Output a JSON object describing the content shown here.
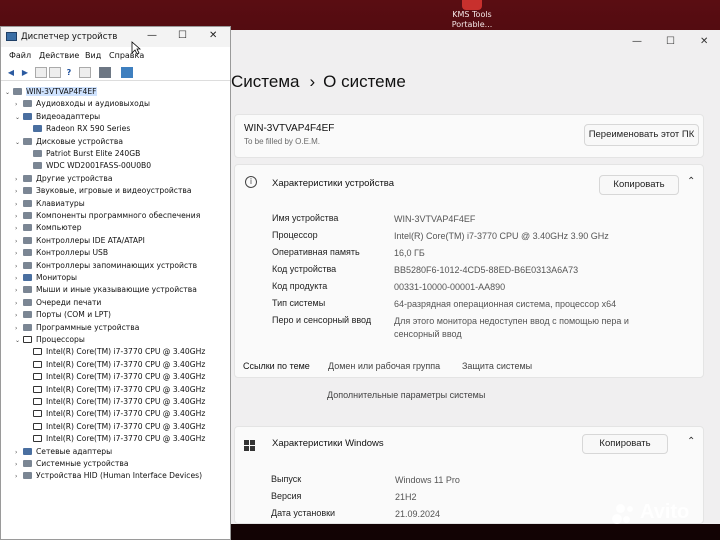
{
  "desktop": {
    "icon_label_1": "KMS Tools",
    "icon_label_2": "Portable..."
  },
  "settings": {
    "breadcrumb": [
      "Система",
      "О системе"
    ],
    "device_name_heading": "WIN-3VTVAP4F4EF",
    "device_subtitle": "To be filled by O.E.M.",
    "rename_button": "Переименовать этот ПК",
    "device_specs_title": "Характеристики устройства",
    "copy_button": "Копировать",
    "specs": [
      {
        "label": "Имя устройства",
        "value": "WIN-3VTVAP4F4EF"
      },
      {
        "label": "Процессор",
        "value": "Intel(R) Core(TM) i7-3770 CPU @ 3.40GHz   3.90 GHz"
      },
      {
        "label": "Оперативная память",
        "value": "16,0 ГБ"
      },
      {
        "label": "Код устройства",
        "value": "BB5280F6-1012-4CD5-88ED-B6E0313A6A73"
      },
      {
        "label": "Код продукта",
        "value": "00331-10000-00001-AA890"
      },
      {
        "label": "Тип системы",
        "value": "64-разрядная операционная система, процессор x64"
      },
      {
        "label": "Перо и сенсорный ввод",
        "value": "Для этого монитора недоступен ввод с помощью пера и сенсорный ввод"
      }
    ],
    "related_label": "Ссылки по теме",
    "related_links": [
      "Домен или рабочая группа",
      "Защита системы"
    ],
    "advanced_link": "Дополнительные параметры системы",
    "windows_specs_title": "Характеристики Windows",
    "windows_copy_button": "Копировать",
    "windows_specs": [
      {
        "label": "Выпуск",
        "value": "Windows 11 Pro"
      },
      {
        "label": "Версия",
        "value": "21H2"
      },
      {
        "label": "Дата установки",
        "value": "21.09.2024"
      }
    ]
  },
  "device_manager": {
    "title": "Диспетчер устройств",
    "menu": [
      "Файл",
      "Действие",
      "Вид",
      "Справка"
    ],
    "tree": [
      {
        "label": "WIN-3VTVAP4F4EF",
        "level": 0,
        "expanded": true,
        "icon": "computer"
      },
      {
        "label": "Аудиовходы и аудиовыходы",
        "level": 1,
        "expanded": false,
        "icon": "audio"
      },
      {
        "label": "Видеоадаптеры",
        "level": 1,
        "expanded": true,
        "icon": "display"
      },
      {
        "label": "Radeon RX 590 Series",
        "level": 2,
        "icon": "gpu"
      },
      {
        "label": "Дисковые устройства",
        "level": 1,
        "expanded": true,
        "icon": "disk"
      },
      {
        "label": "Patriot Burst Elite 240GB",
        "level": 2,
        "icon": "disk"
      },
      {
        "label": "WDC WD2001FASS-00U0B0",
        "level": 2,
        "icon": "disk"
      },
      {
        "label": "Другие устройства",
        "level": 1,
        "expanded": false,
        "icon": "other"
      },
      {
        "label": "Звуковые, игровые и видеоустройства",
        "level": 1,
        "expanded": false,
        "icon": "sound"
      },
      {
        "label": "Клавиатуры",
        "level": 1,
        "expanded": false,
        "icon": "keyboard"
      },
      {
        "label": "Компоненты программного обеспечения",
        "level": 1,
        "expanded": false,
        "icon": "software"
      },
      {
        "label": "Компьютер",
        "level": 1,
        "expanded": false,
        "icon": "computer"
      },
      {
        "label": "Контроллеры IDE ATA/ATAPI",
        "level": 1,
        "expanded": false,
        "icon": "controller"
      },
      {
        "label": "Контроллеры USB",
        "level": 1,
        "expanded": false,
        "icon": "usb"
      },
      {
        "label": "Контроллеры запоминающих устройств",
        "level": 1,
        "expanded": false,
        "icon": "storage"
      },
      {
        "label": "Мониторы",
        "level": 1,
        "expanded": false,
        "icon": "monitor"
      },
      {
        "label": "Мыши и иные указывающие устройства",
        "level": 1,
        "expanded": false,
        "icon": "mouse"
      },
      {
        "label": "Очереди печати",
        "level": 1,
        "expanded": false,
        "icon": "printer"
      },
      {
        "label": "Порты (COM и LPT)",
        "level": 1,
        "expanded": false,
        "icon": "port"
      },
      {
        "label": "Программные устройства",
        "level": 1,
        "expanded": false,
        "icon": "software"
      },
      {
        "label": "Процессоры",
        "level": 1,
        "expanded": true,
        "icon": "cpu"
      },
      {
        "label": "Intel(R) Core(TM) i7-3770 CPU @ 3.40GHz",
        "level": 2,
        "icon": "cpu"
      },
      {
        "label": "Intel(R) Core(TM) i7-3770 CPU @ 3.40GHz",
        "level": 2,
        "icon": "cpu"
      },
      {
        "label": "Intel(R) Core(TM) i7-3770 CPU @ 3.40GHz",
        "level": 2,
        "icon": "cpu"
      },
      {
        "label": "Intel(R) Core(TM) i7-3770 CPU @ 3.40GHz",
        "level": 2,
        "icon": "cpu"
      },
      {
        "label": "Intel(R) Core(TM) i7-3770 CPU @ 3.40GHz",
        "level": 2,
        "icon": "cpu"
      },
      {
        "label": "Intel(R) Core(TM) i7-3770 CPU @ 3.40GHz",
        "level": 2,
        "icon": "cpu"
      },
      {
        "label": "Intel(R) Core(TM) i7-3770 CPU @ 3.40GHz",
        "level": 2,
        "icon": "cpu"
      },
      {
        "label": "Intel(R) Core(TM) i7-3770 CPU @ 3.40GHz",
        "level": 2,
        "icon": "cpu"
      },
      {
        "label": "Сетевые адаптеры",
        "level": 1,
        "expanded": false,
        "icon": "network"
      },
      {
        "label": "Системные устройства",
        "level": 1,
        "expanded": false,
        "icon": "system"
      },
      {
        "label": "Устройства HID (Human Interface Devices)",
        "level": 1,
        "expanded": false,
        "icon": "hid"
      }
    ]
  },
  "watermark": {
    "text": "Avito"
  }
}
